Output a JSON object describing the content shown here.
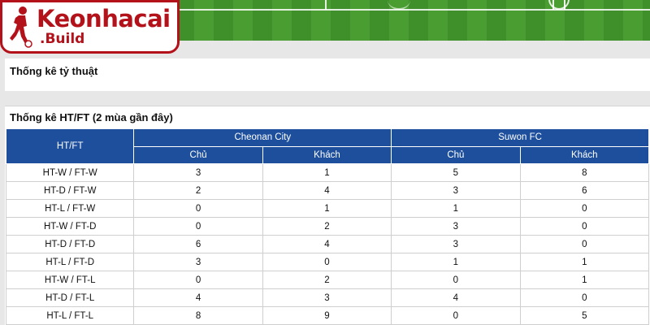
{
  "logo": {
    "name": "Keonhacai",
    "suffix": ".Build",
    "colors": {
      "brand_red": "#b3121b"
    }
  },
  "sections": {
    "ratio_title": "Thống kê tỷ thuật",
    "htft_title": "Thống kê HT/FT (2 mùa gần đây)"
  },
  "table": {
    "header_label": "HT/FT",
    "teams": [
      "Cheonan City",
      "Suwon FC"
    ],
    "sub_headers": [
      "Chủ",
      "Khách",
      "Chủ",
      "Khách"
    ],
    "header_color": "#1d4f9c",
    "rows": [
      {
        "label": "HT-W / FT-W",
        "values": [
          "3",
          "1",
          "5",
          "8"
        ]
      },
      {
        "label": "HT-D / FT-W",
        "values": [
          "2",
          "4",
          "3",
          "6"
        ]
      },
      {
        "label": "HT-L / FT-W",
        "values": [
          "0",
          "1",
          "1",
          "0"
        ]
      },
      {
        "label": "HT-W / FT-D",
        "values": [
          "0",
          "2",
          "3",
          "0"
        ]
      },
      {
        "label": "HT-D / FT-D",
        "values": [
          "6",
          "4",
          "3",
          "0"
        ]
      },
      {
        "label": "HT-L / FT-D",
        "values": [
          "3",
          "0",
          "1",
          "1"
        ]
      },
      {
        "label": "HT-W / FT-L",
        "values": [
          "0",
          "2",
          "0",
          "1"
        ]
      },
      {
        "label": "HT-D / FT-L",
        "values": [
          "4",
          "3",
          "4",
          "0"
        ]
      },
      {
        "label": "HT-L / FT-L",
        "values": [
          "8",
          "9",
          "0",
          "5"
        ]
      }
    ]
  }
}
